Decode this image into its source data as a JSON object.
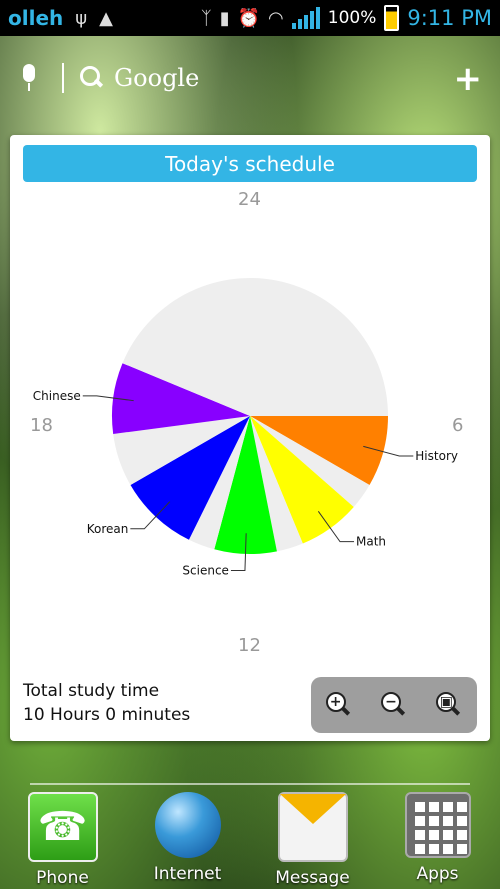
{
  "status_bar": {
    "carrier": "olleh",
    "battery": "100%",
    "time": "9:11 PM",
    "icons": [
      "usb-icon",
      "android-debug-icon",
      "bluetooth-icon",
      "vibrate-icon",
      "alarm-icon",
      "wifi-icon",
      "signal-icon",
      "battery-icon"
    ]
  },
  "search": {
    "label": "Google",
    "icons": [
      "mic-icon",
      "search-icon",
      "plus-icon"
    ]
  },
  "widget": {
    "title": "Today's schedule",
    "hours": {
      "top": "24",
      "right": "6",
      "bottom": "12",
      "left": "18"
    },
    "total_label": "Total study time",
    "total_value": "10 Hours 0 minutes",
    "zoom_buttons": [
      "zoom-in-icon",
      "zoom-out-icon",
      "zoom-fit-icon"
    ]
  },
  "dock": {
    "items": [
      {
        "label": "Phone",
        "icon": "phone-icon"
      },
      {
        "label": "Internet",
        "icon": "globe-icon"
      },
      {
        "label": "Message",
        "icon": "envelope-icon"
      },
      {
        "label": "Apps",
        "icon": "apps-grid-icon"
      }
    ]
  },
  "chart_data": {
    "type": "pie",
    "title": "Today's schedule",
    "clock_hours": 24,
    "slices": [
      {
        "label": "History",
        "start": 6,
        "end": 8,
        "color": "#ff8000"
      },
      {
        "label": "",
        "start": 8,
        "end": 8.75,
        "color": "#eeeeee"
      },
      {
        "label": "Math",
        "start": 8.75,
        "end": 10.5,
        "color": "#ffff00"
      },
      {
        "label": "",
        "start": 10.5,
        "end": 11.25,
        "color": "#eeeeee"
      },
      {
        "label": "Science",
        "start": 11.25,
        "end": 13,
        "color": "#00ff00"
      },
      {
        "label": "",
        "start": 13,
        "end": 13.75,
        "color": "#eeeeee"
      },
      {
        "label": "Korean",
        "start": 13.75,
        "end": 16,
        "color": "#0000ff"
      },
      {
        "label": "",
        "start": 16,
        "end": 17.5,
        "color": "#eeeeee"
      },
      {
        "label": "Chinese",
        "start": 17.5,
        "end": 19.5,
        "color": "#8800ff"
      },
      {
        "label": "",
        "start": 19.5,
        "end": 30,
        "color": "#eeeeee"
      }
    ]
  }
}
